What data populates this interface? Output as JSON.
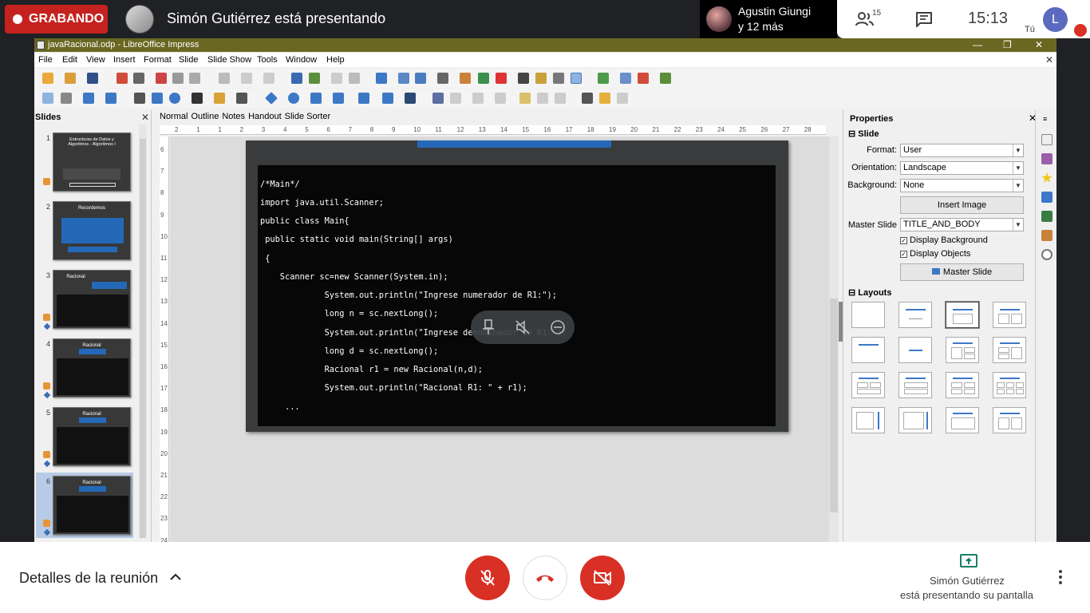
{
  "meet": {
    "recording_label": "GRABANDO",
    "presenter_title": "Simón Gutiérrez está presentando",
    "participant_name": "Agustin Giungi",
    "participant_more": "y 12 más",
    "people_count": "15",
    "clock": "15:13",
    "self_initial": "L",
    "self_label": "Tú",
    "details_label": "Detalles de la reunión",
    "presenting_line1": "Simón Gutiérrez",
    "presenting_line2": "está presentando su pantalla",
    "colors": {
      "record": "#c5221f",
      "end_call": "#d93025",
      "avatar": "#5b6abf"
    }
  },
  "lo": {
    "window_title": "javaRacional.odp - LibreOffice Impress",
    "menu": [
      "File",
      "Edit",
      "View",
      "Insert",
      "Format",
      "Slide",
      "Slide Show",
      "Tools",
      "Window",
      "Help"
    ],
    "slides_pane_title": "Slides",
    "view_tabs": [
      "Normal",
      "Outline",
      "Notes",
      "Handout",
      "Slide Sorter"
    ],
    "ruler_numbers": [
      "2",
      "1",
      "1",
      "2",
      "3",
      "4",
      "5",
      "6",
      "7",
      "8",
      "9",
      "10",
      "11",
      "12",
      "13",
      "14",
      "15",
      "16",
      "17",
      "18",
      "19",
      "20",
      "21",
      "22",
      "23",
      "24",
      "25",
      "26",
      "27",
      "28"
    ],
    "vruler_numbers": [
      "6",
      "7",
      "8",
      "9",
      "10",
      "11",
      "12",
      "13",
      "14",
      "15",
      "16",
      "17",
      "18",
      "19",
      "20",
      "21",
      "22",
      "23",
      "24"
    ],
    "thumbnails": [
      {
        "num": "1",
        "title": "Estructuras de Datos y Algoritmos - Algoritmos I"
      },
      {
        "num": "2",
        "title": "Recordemos"
      },
      {
        "num": "3",
        "title": "Racional"
      },
      {
        "num": "4",
        "title": "Racional"
      },
      {
        "num": "5",
        "title": "Racional"
      },
      {
        "num": "6",
        "title": "Racional"
      }
    ],
    "code_lines": [
      "/*Main*/",
      "import java.util.Scanner;",
      "public class Main{",
      " public static void main(String[] args)",
      " {",
      "    Scanner sc=new Scanner(System.in);",
      "             System.out.println(\"Ingrese numerador de R1:\");",
      "             long n = sc.nextLong();",
      "             System.out.println(\"Ingrese denominador de R1:\");",
      "             long d = sc.nextLong();",
      "             Racional r1 = new Racional(n,d);",
      "             System.out.println(\"Racional R1: \" + r1);",
      "     ..."
    ],
    "properties": {
      "title": "Properties",
      "slide_section": "Slide",
      "format_label": "Format:",
      "format_value": "User",
      "orientation_label": "Orientation:",
      "orientation_value": "Landscape",
      "background_label": "Background:",
      "background_value": "None",
      "insert_image": "Insert Image",
      "master_label": "Master Slide",
      "master_value": "TITLE_AND_BODY",
      "display_background": "Display Background",
      "display_objects": "Display Objects",
      "master_button": "Master Slide",
      "layouts_section": "Layouts"
    }
  }
}
